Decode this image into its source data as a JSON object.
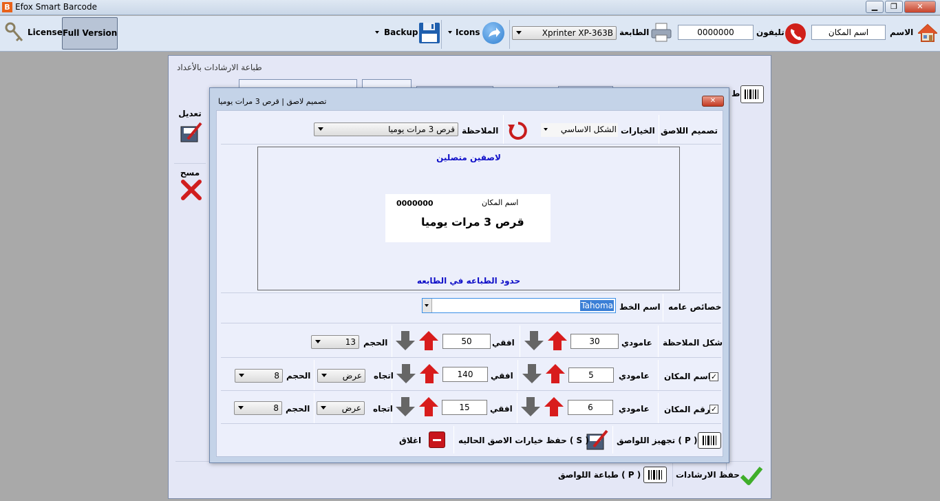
{
  "window": {
    "title": "Efox Smart Barcode",
    "icon_letter": "B"
  },
  "toolbar": {
    "name_label": "الاسم",
    "name_value": "اسم المكان",
    "phone_label": "تليفون",
    "phone_value": "0000000",
    "printer_label": "الطابعة",
    "printer_value": "Xprinter XP-363B",
    "icons_label": "Icons",
    "backup_label": "Backup",
    "full_version_label": "Full Version",
    "license_label": "License"
  },
  "main": {
    "title": "طباعة الارشادات بالأعداد",
    "edit_label": "تعديل",
    "delete_label": "مسح",
    "side_letter": "ط",
    "save_label": "حفظ الارشادات",
    "print_label": "طباعة اللواصق  ( P )"
  },
  "dialog": {
    "title": "تصميم لاصق | قرص 3 مرات يوميا",
    "design_label": "تصميم اللاصق",
    "options_label": "الخيارات",
    "options_value": "الشكل الاساسي",
    "note_label": "الملاحظة",
    "note_value": "قرص 3 مرات يوميا",
    "preview": {
      "top_text": "لاصقين متصلين",
      "bottom_text": "حدود الطباعه في الطابعه",
      "label_place": "اسم المكان",
      "label_number": "0000000",
      "label_note": "قرص 3 مرات يوميا"
    },
    "general_label": "خصائص عامه",
    "font_label": "اسم الخط",
    "font_value": "Tahoma",
    "rows": [
      {
        "label": "شكل الملاحظة",
        "checkbox": false,
        "vertical_label": "عامودي",
        "vertical": "30",
        "horizontal_label": "افقي",
        "horizontal": "50",
        "direction_label": "",
        "direction": "",
        "size_label": "الحجم",
        "size": "13"
      },
      {
        "label": "اسم المكان",
        "checkbox": true,
        "vertical_label": "عامودي",
        "vertical": "5",
        "horizontal_label": "افقي",
        "horizontal": "140",
        "direction_label": "اتجاه",
        "direction": "عرض",
        "size_label": "الحجم",
        "size": "8"
      },
      {
        "label": "رقم المكان",
        "checkbox": true,
        "vertical_label": "عامودي",
        "vertical": "6",
        "horizontal_label": "افقي",
        "horizontal": "15",
        "direction_label": "اتجاه",
        "direction": "عرض",
        "size_label": "الحجم",
        "size": "8"
      }
    ],
    "prepare_label": "تجهيز اللواصق  ( P )",
    "save_current_label": "حفظ خيارات الاصق الحاليه  ( S )",
    "close_label": "اغلاق",
    "check_mark": "✓"
  },
  "colors": {
    "accent_red": "#d81c1c",
    "preview_blue": "#1010c8",
    "dialog_frame": "#c4d3e8"
  }
}
